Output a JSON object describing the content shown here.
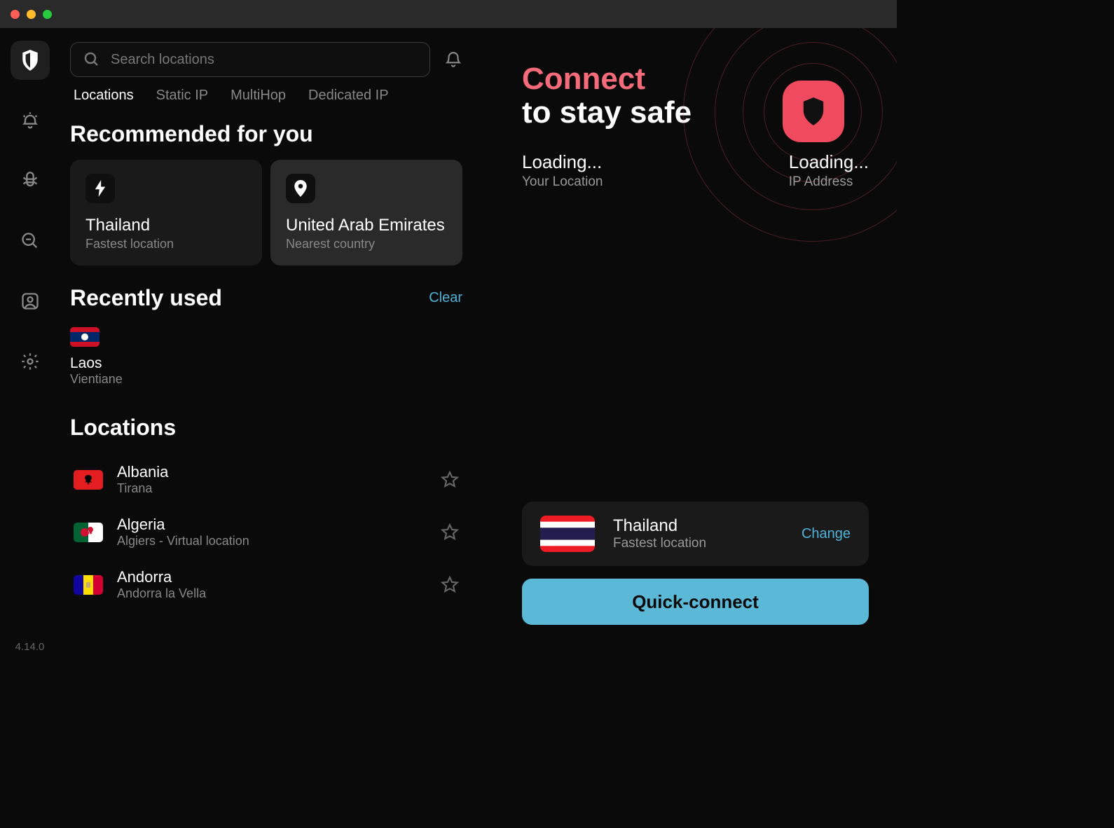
{
  "search": {
    "placeholder": "Search locations"
  },
  "tabs": {
    "locations": "Locations",
    "static": "Static IP",
    "multihop": "MultiHop",
    "dedicated": "Dedicated IP"
  },
  "recommended": {
    "title": "Recommended for you",
    "cards": [
      {
        "name": "Thailand",
        "sub": "Fastest location"
      },
      {
        "name": "United Arab Emirates",
        "sub": "Nearest country"
      }
    ]
  },
  "recent": {
    "title": "Recently used",
    "clear": "Clear",
    "items": [
      {
        "name": "Laos",
        "sub": "Vientiane"
      }
    ]
  },
  "locations": {
    "title": "Locations",
    "items": [
      {
        "name": "Albania",
        "sub": "Tirana"
      },
      {
        "name": "Algeria",
        "sub": "Algiers - Virtual location"
      },
      {
        "name": "Andorra",
        "sub": "Andorra la Vella"
      }
    ]
  },
  "connect": {
    "title1": "Connect",
    "title2": "to stay safe",
    "locationValue": "Loading...",
    "locationLabel": "Your Location",
    "ipValue": "Loading...",
    "ipLabel": "IP Address",
    "selectedName": "Thailand",
    "selectedSub": "Fastest location",
    "change": "Change",
    "button": "Quick-connect"
  },
  "version": "4.14.0"
}
